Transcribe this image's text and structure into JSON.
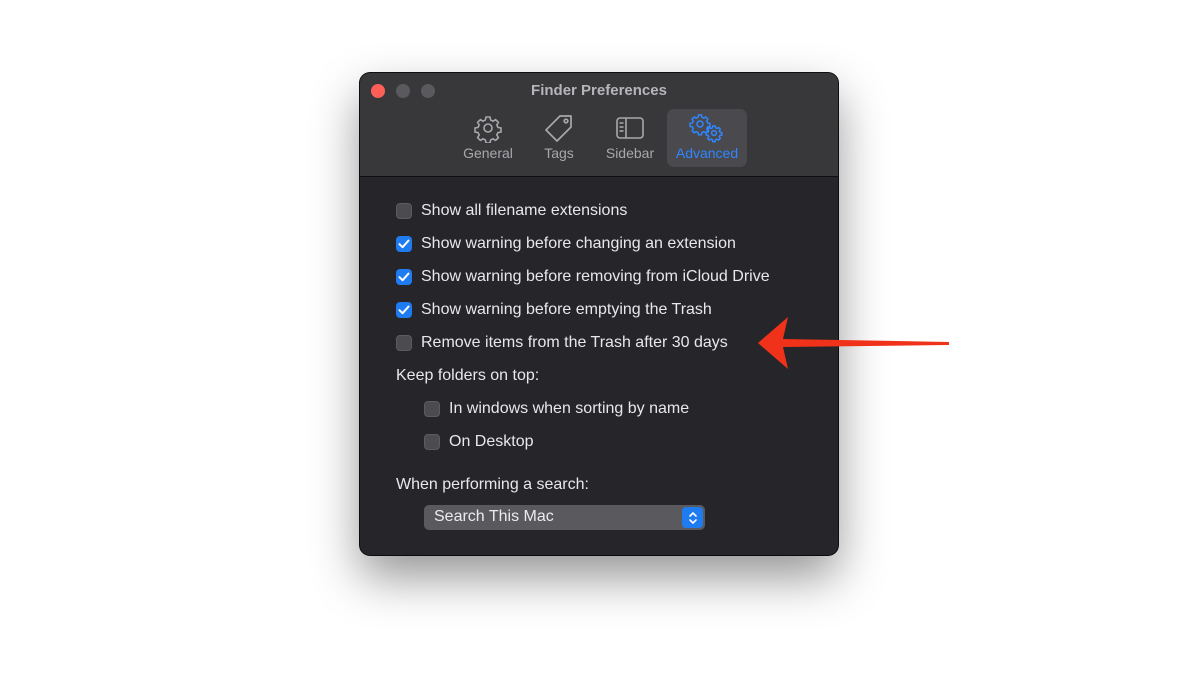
{
  "window": {
    "title": "Finder Preferences"
  },
  "toolbar": {
    "tabs": [
      {
        "label": "General",
        "icon": "gear-icon"
      },
      {
        "label": "Tags",
        "icon": "tag-icon"
      },
      {
        "label": "Sidebar",
        "icon": "sidebar-icon"
      },
      {
        "label": "Advanced",
        "icon": "gears-icon",
        "selected": true
      }
    ]
  },
  "options": [
    {
      "label": "Show all filename extensions",
      "checked": false
    },
    {
      "label": "Show warning before changing an extension",
      "checked": true
    },
    {
      "label": "Show warning before removing from iCloud Drive",
      "checked": true
    },
    {
      "label": "Show warning before emptying the Trash",
      "checked": true
    },
    {
      "label": "Remove items from the Trash after 30 days",
      "checked": false
    }
  ],
  "keep_folders": {
    "heading": "Keep folders on top:",
    "options": [
      {
        "label": "In windows when sorting by name",
        "checked": false
      },
      {
        "label": "On Desktop",
        "checked": false
      }
    ]
  },
  "search": {
    "heading": "When performing a search:",
    "selected": "Search This Mac"
  },
  "colors": {
    "accent": "#1f7bf0",
    "annotation_arrow": "#f0321a",
    "close_button": "#ff5f57"
  }
}
